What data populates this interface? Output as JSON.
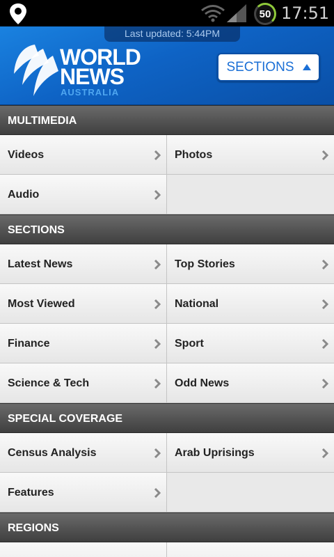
{
  "status": {
    "time": "17:51",
    "battery": "50"
  },
  "header": {
    "updated": "Last updated: 5:44PM",
    "logo_line1": "WORLD",
    "logo_line2": "NEWS",
    "logo_line3": "AUSTRALIA",
    "sections_button": "SECTIONS"
  },
  "groups": [
    {
      "title": "MULTIMEDIA",
      "items": [
        "Videos",
        "Photos",
        "Audio"
      ]
    },
    {
      "title": "SECTIONS",
      "items": [
        "Latest News",
        "Top Stories",
        "Most Viewed",
        "National",
        "Finance",
        "Sport",
        "Science & Tech",
        "Odd News"
      ]
    },
    {
      "title": "SPECIAL COVERAGE",
      "items": [
        "Census Analysis",
        "Arab Uprisings",
        "Features"
      ]
    },
    {
      "title": "REGIONS",
      "items": [
        "",
        ""
      ]
    }
  ],
  "colors": {
    "accent": "#1a6fd6",
    "header_blue": "#0e63c5",
    "section_bar": "#4a4a4a"
  }
}
